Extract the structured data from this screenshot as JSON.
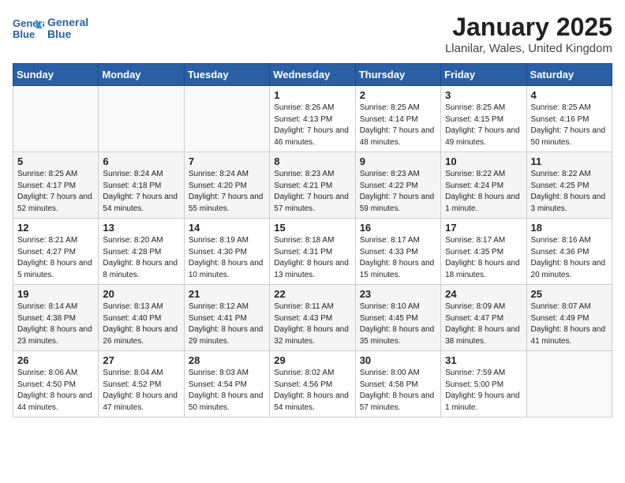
{
  "header": {
    "logo_line1": "General",
    "logo_line2": "Blue",
    "main_title": "January 2025",
    "subtitle": "Llanilar, Wales, United Kingdom"
  },
  "days_of_week": [
    "Sunday",
    "Monday",
    "Tuesday",
    "Wednesday",
    "Thursday",
    "Friday",
    "Saturday"
  ],
  "weeks": [
    [
      {
        "day": "",
        "sunrise": "",
        "sunset": "",
        "daylight": ""
      },
      {
        "day": "",
        "sunrise": "",
        "sunset": "",
        "daylight": ""
      },
      {
        "day": "",
        "sunrise": "",
        "sunset": "",
        "daylight": ""
      },
      {
        "day": "1",
        "sunrise": "Sunrise: 8:26 AM",
        "sunset": "Sunset: 4:13 PM",
        "daylight": "Daylight: 7 hours and 46 minutes."
      },
      {
        "day": "2",
        "sunrise": "Sunrise: 8:25 AM",
        "sunset": "Sunset: 4:14 PM",
        "daylight": "Daylight: 7 hours and 48 minutes."
      },
      {
        "day": "3",
        "sunrise": "Sunrise: 8:25 AM",
        "sunset": "Sunset: 4:15 PM",
        "daylight": "Daylight: 7 hours and 49 minutes."
      },
      {
        "day": "4",
        "sunrise": "Sunrise: 8:25 AM",
        "sunset": "Sunset: 4:16 PM",
        "daylight": "Daylight: 7 hours and 50 minutes."
      }
    ],
    [
      {
        "day": "5",
        "sunrise": "Sunrise: 8:25 AM",
        "sunset": "Sunset: 4:17 PM",
        "daylight": "Daylight: 7 hours and 52 minutes."
      },
      {
        "day": "6",
        "sunrise": "Sunrise: 8:24 AM",
        "sunset": "Sunset: 4:18 PM",
        "daylight": "Daylight: 7 hours and 54 minutes."
      },
      {
        "day": "7",
        "sunrise": "Sunrise: 8:24 AM",
        "sunset": "Sunset: 4:20 PM",
        "daylight": "Daylight: 7 hours and 55 minutes."
      },
      {
        "day": "8",
        "sunrise": "Sunrise: 8:23 AM",
        "sunset": "Sunset: 4:21 PM",
        "daylight": "Daylight: 7 hours and 57 minutes."
      },
      {
        "day": "9",
        "sunrise": "Sunrise: 8:23 AM",
        "sunset": "Sunset: 4:22 PM",
        "daylight": "Daylight: 7 hours and 59 minutes."
      },
      {
        "day": "10",
        "sunrise": "Sunrise: 8:22 AM",
        "sunset": "Sunset: 4:24 PM",
        "daylight": "Daylight: 8 hours and 1 minute."
      },
      {
        "day": "11",
        "sunrise": "Sunrise: 8:22 AM",
        "sunset": "Sunset: 4:25 PM",
        "daylight": "Daylight: 8 hours and 3 minutes."
      }
    ],
    [
      {
        "day": "12",
        "sunrise": "Sunrise: 8:21 AM",
        "sunset": "Sunset: 4:27 PM",
        "daylight": "Daylight: 8 hours and 5 minutes."
      },
      {
        "day": "13",
        "sunrise": "Sunrise: 8:20 AM",
        "sunset": "Sunset: 4:28 PM",
        "daylight": "Daylight: 8 hours and 8 minutes."
      },
      {
        "day": "14",
        "sunrise": "Sunrise: 8:19 AM",
        "sunset": "Sunset: 4:30 PM",
        "daylight": "Daylight: 8 hours and 10 minutes."
      },
      {
        "day": "15",
        "sunrise": "Sunrise: 8:18 AM",
        "sunset": "Sunset: 4:31 PM",
        "daylight": "Daylight: 8 hours and 13 minutes."
      },
      {
        "day": "16",
        "sunrise": "Sunrise: 8:17 AM",
        "sunset": "Sunset: 4:33 PM",
        "daylight": "Daylight: 8 hours and 15 minutes."
      },
      {
        "day": "17",
        "sunrise": "Sunrise: 8:17 AM",
        "sunset": "Sunset: 4:35 PM",
        "daylight": "Daylight: 8 hours and 18 minutes."
      },
      {
        "day": "18",
        "sunrise": "Sunrise: 8:16 AM",
        "sunset": "Sunset: 4:36 PM",
        "daylight": "Daylight: 8 hours and 20 minutes."
      }
    ],
    [
      {
        "day": "19",
        "sunrise": "Sunrise: 8:14 AM",
        "sunset": "Sunset: 4:38 PM",
        "daylight": "Daylight: 8 hours and 23 minutes."
      },
      {
        "day": "20",
        "sunrise": "Sunrise: 8:13 AM",
        "sunset": "Sunset: 4:40 PM",
        "daylight": "Daylight: 8 hours and 26 minutes."
      },
      {
        "day": "21",
        "sunrise": "Sunrise: 8:12 AM",
        "sunset": "Sunset: 4:41 PM",
        "daylight": "Daylight: 8 hours and 29 minutes."
      },
      {
        "day": "22",
        "sunrise": "Sunrise: 8:11 AM",
        "sunset": "Sunset: 4:43 PM",
        "daylight": "Daylight: 8 hours and 32 minutes."
      },
      {
        "day": "23",
        "sunrise": "Sunrise: 8:10 AM",
        "sunset": "Sunset: 4:45 PM",
        "daylight": "Daylight: 8 hours and 35 minutes."
      },
      {
        "day": "24",
        "sunrise": "Sunrise: 8:09 AM",
        "sunset": "Sunset: 4:47 PM",
        "daylight": "Daylight: 8 hours and 38 minutes."
      },
      {
        "day": "25",
        "sunrise": "Sunrise: 8:07 AM",
        "sunset": "Sunset: 4:49 PM",
        "daylight": "Daylight: 8 hours and 41 minutes."
      }
    ],
    [
      {
        "day": "26",
        "sunrise": "Sunrise: 8:06 AM",
        "sunset": "Sunset: 4:50 PM",
        "daylight": "Daylight: 8 hours and 44 minutes."
      },
      {
        "day": "27",
        "sunrise": "Sunrise: 8:04 AM",
        "sunset": "Sunset: 4:52 PM",
        "daylight": "Daylight: 8 hours and 47 minutes."
      },
      {
        "day": "28",
        "sunrise": "Sunrise: 8:03 AM",
        "sunset": "Sunset: 4:54 PM",
        "daylight": "Daylight: 8 hours and 50 minutes."
      },
      {
        "day": "29",
        "sunrise": "Sunrise: 8:02 AM",
        "sunset": "Sunset: 4:56 PM",
        "daylight": "Daylight: 8 hours and 54 minutes."
      },
      {
        "day": "30",
        "sunrise": "Sunrise: 8:00 AM",
        "sunset": "Sunset: 4:58 PM",
        "daylight": "Daylight: 8 hours and 57 minutes."
      },
      {
        "day": "31",
        "sunrise": "Sunrise: 7:59 AM",
        "sunset": "Sunset: 5:00 PM",
        "daylight": "Daylight: 9 hours and 1 minute."
      },
      {
        "day": "",
        "sunrise": "",
        "sunset": "",
        "daylight": ""
      }
    ]
  ]
}
